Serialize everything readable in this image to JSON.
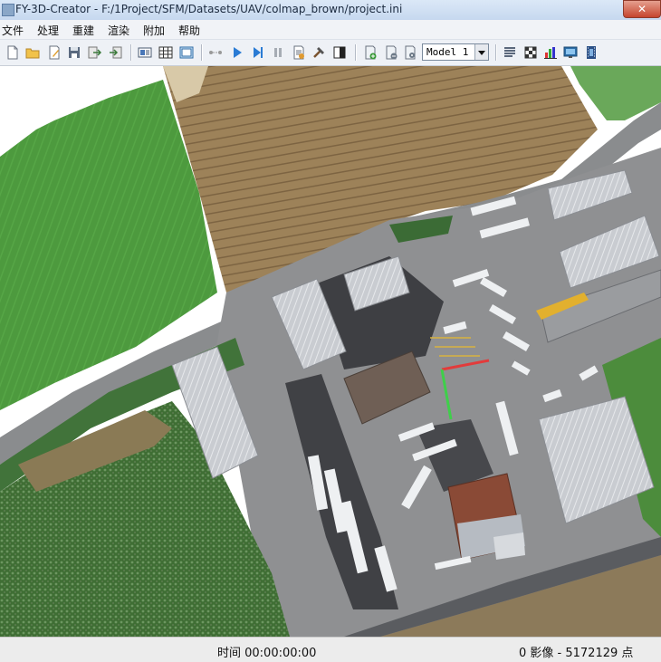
{
  "window": {
    "title": "FY-3D-Creator - F:/1Project/SFM/Datasets/UAV/colmap_brown/project.ini",
    "close_glyph": "✕"
  },
  "menu": {
    "items": [
      "文件",
      "处理",
      "重建",
      "渲染",
      "附加",
      "帮助"
    ]
  },
  "toolbar": {
    "file_icons": [
      "new-file-icon",
      "open-folder-icon",
      "edit-file-icon",
      "save-icon",
      "export-icon",
      "import-icon"
    ],
    "view_icons": [
      "image-view-icon",
      "grid-view-icon",
      "layout-view-icon"
    ],
    "process_icons": [
      "connect-icon",
      "play-icon",
      "step-forward-icon",
      "pause-icon",
      "report-icon",
      "hammer-icon",
      "contrast-icon"
    ],
    "layer_icons": [
      "add-layer-icon",
      "remove-layer-icon",
      "layer-settings-icon"
    ],
    "model_select": {
      "value": "Model 1",
      "options": [
        "Model 1"
      ]
    },
    "extra_icons": [
      "list-icon",
      "checker-icon",
      "bar-chart-icon",
      "screen-capture-icon",
      "film-icon"
    ]
  },
  "status": {
    "time": "时间 00:00:00:00",
    "count": "0 影像 - 5172129 点"
  },
  "colors": {
    "field_green": "#4f9a3f",
    "field_brown": "#9b7f57",
    "road": "#7c7e80",
    "roof": "#cfd2d6",
    "asphalt": "#3f4044"
  }
}
